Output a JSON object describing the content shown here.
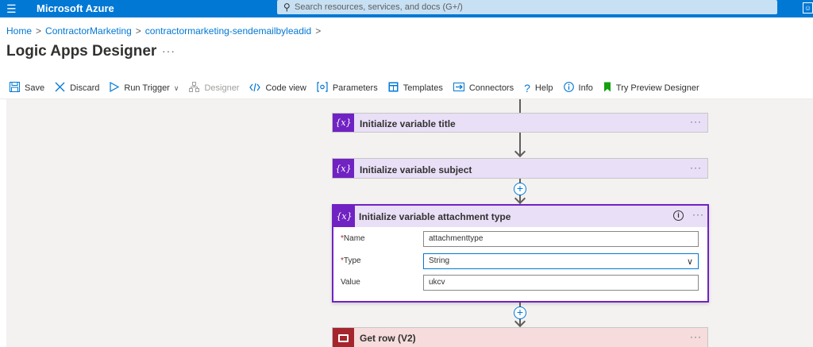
{
  "topbar": {
    "menu_icon": "hamburger-icon",
    "brand": "Microsoft Azure",
    "search_placeholder": "Search resources, services, and docs (G+/)",
    "search_icon": "search-icon",
    "right_icon": "feedback-icon"
  },
  "breadcrumb": {
    "items": [
      "Home",
      "ContractorMarketing",
      "contractormarketing-sendemailbyleadid"
    ],
    "separator": ">"
  },
  "page": {
    "title": "Logic Apps Designer",
    "more": "···"
  },
  "toolbar": {
    "save": "Save",
    "discard": "Discard",
    "run_trigger": "Run Trigger",
    "designer": "Designer",
    "code_view": "Code view",
    "parameters": "Parameters",
    "templates": "Templates",
    "connectors": "Connectors",
    "help": "Help",
    "info": "Info",
    "try_preview": "Try Preview Designer",
    "chevron": "∨"
  },
  "workflow": {
    "chip_label": "{x}",
    "more": "···",
    "plus": "+",
    "steps": [
      {
        "title": "Initialize variable title"
      },
      {
        "title": "Initialize variable subject"
      }
    ],
    "expanded_step": {
      "title": "Initialize variable attachment type",
      "info": "i",
      "required_mark": "*",
      "fields": {
        "name": {
          "label": "Name",
          "value": "attachmenttype"
        },
        "type": {
          "label": "Type",
          "value": "String"
        },
        "value": {
          "label": "Value",
          "value": "ukcv"
        }
      },
      "type_chevron": "∨"
    },
    "next_step": {
      "title": "Get row (V2)"
    }
  },
  "colors": {
    "azure_blue": "#0078d4",
    "variable_purple": "#7022c2",
    "variable_card_bg": "#e9dff7",
    "sql_red": "#a4262c",
    "sql_card_bg": "#f6dcdc",
    "canvas_bg": "#f3f2f1"
  }
}
